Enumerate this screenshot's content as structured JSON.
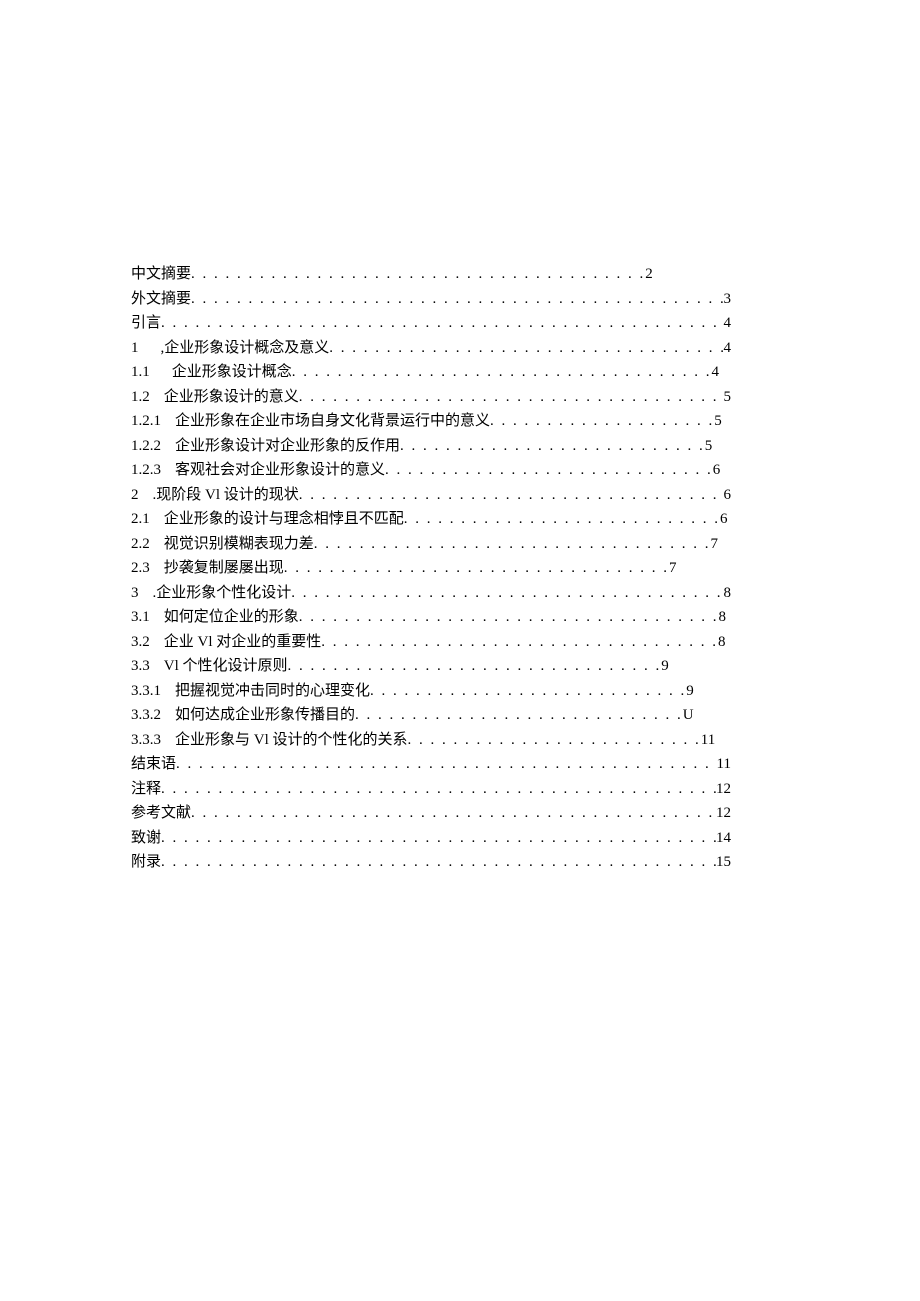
{
  "toc": [
    {
      "num": "",
      "title": "中文摘要",
      "dots": " . . . . . . . . . . . . . . . . . . . . . . . . . . . . . . . . . . . . . . . .",
      "page": "2"
    },
    {
      "num": "",
      "title": "外文摘要",
      "dots": ". . . . . . . . . . . . . . . . . . . . . . . . . . . . . . . . . . . . . . . . . . . . . . . . .",
      "page": "3"
    },
    {
      "num": "",
      "title": "引言",
      "dots": ". . . . . . . . . . . . . . . . . . . . . . . . . . . . . . . . . . . . . . . . . . . . . . . . . . . .",
      "page": "4"
    },
    {
      "num": "1",
      "title": ",企业形象设计概念及意义",
      "dots": " . . . . . . . . . . . . . . . . . . . . . . . . . . . . . . . . . . . . .",
      "page": "4",
      "wide": true
    },
    {
      "num": "1.1",
      "title": "企业形象设计概念",
      "dots": " . . . . . . . . . . . . . . . . . . . . . . . . . . . . . . . . . . . . .",
      "page": "4",
      "wide": true
    },
    {
      "num": "1.2",
      "title": "企业形象设计的意义",
      "dots": " . . . . . . . . . . . . . . . . . . . . . . . . . . . . . . . . . . . . . .",
      "page": "5"
    },
    {
      "num": "1.2.1",
      "title": "企业形象在企业市场自身文化背景运行中的意义",
      "dots": ". . . . . . . . . . . . . . . . . . . .",
      "page": "5"
    },
    {
      "num": "1.2.2",
      "title": "企业形象设计对企业形象的反作用",
      "dots": " . . . . . . . . . . . . . . . . . . . . . . . . . . .",
      "page": "5"
    },
    {
      "num": "1.2.3",
      "title": "客观社会对企业形象设计的意义",
      "dots": " . . . . . . . . . . . . . . . . . . . . . . . . . . . . .",
      "page": "6"
    },
    {
      "num": "2",
      "title": ".现阶段 Vl 设计的现状",
      "dots": " . . . . . . . . . . . . . . . . . . . . . . . . . . . . . . . . . . . . . .",
      "page": "6"
    },
    {
      "num": "2.1",
      "title": "企业形象的设计与理念相悖且不匹配",
      "dots": " . . . . . . . . . . . . . . . . . . . . . . . . . . . .",
      "page": "6"
    },
    {
      "num": "2.2",
      "title": "视觉识别模糊表现力差",
      "dots": " . . . . . . . . . . . . . . . . . . . . . . . . . . . . . . . . . . .",
      "page": "7"
    },
    {
      "num": "2.3",
      "title": "抄袭复制屡屡出现",
      "dots": ". . . . . . . . . . . . . . . . . . . . . . . . . . . . . . . . . .",
      "page": "7"
    },
    {
      "num": "3",
      "title": ".企业形象个性化设计",
      "dots": " . . . . . . . . . . . . . . . . . . . . . . . . . . . . . . . . . . . . . . .",
      "page": "8"
    },
    {
      "num": "3.1",
      "title": "如何定位企业的形象",
      "dots": " . . . . . . . . . . . . . . . . . . . . . . . . . . . . . . . . . . . . .",
      "page": "8"
    },
    {
      "num": "3.2",
      "title": "企业 Vl 对企业的重要性",
      "dots": " . . . . . . . . . . . . . . . . . . . . . . . . . . . . . . . . . . .",
      "page": "8"
    },
    {
      "num": "3.3",
      "title": "Vl 个性化设计原则",
      "dots": " . . . . . . . . . . . . . . . . . . . . . . . . . . . . . . . . .",
      "page": "9"
    },
    {
      "num": "3.3.1",
      "title": "把握视觉冲击同时的心理变化",
      "dots": " . . . . . . . . . . . . . . . . . . . . . . . . . . . .",
      "page": "9"
    },
    {
      "num": "3.3.2",
      "title": "如何达成企业形象传播目的",
      "dots": " . . . . . . . . . . . . . . . . . . . . . . . . . . . . .",
      "page": "U"
    },
    {
      "num": "3.3.3",
      "title": "企业形象与 Vl 设计的个性化的关系",
      "dots": " . . . . . . . . . . . . . . . . . . . . . . . . . .",
      "page": " 11"
    },
    {
      "num": "",
      "title": "结束语",
      "dots": ". . . . . . . . . . . . . . . . . . . . . . . . . . . . . . . . . . . . . . . . . . . . . . . . . .",
      "page": " 11"
    },
    {
      "num": "",
      "title": "注释",
      "dots": ". . . . . . . . . . . . . . . . . . . . . . . . . . . . . . . . . . . . . . . . . . . . . . . . . . . .",
      "page": " 12"
    },
    {
      "num": "",
      "title": "参考文献",
      "dots": ". . . . . . . . . . . . . . . . . . . . . . . . . . . . . . . . . . . . . . . . . . . . . . . . .",
      "page": " 12"
    },
    {
      "num": "",
      "title": "致谢",
      "dots": ". . . . . . . . . . . . . . . . . . . . . . . . . . . . . . . . . . . . . . . . . . . . . . . . . . . . . .",
      "page": " 14"
    },
    {
      "num": "",
      "title": "附录",
      "dots": ". . . . . . . . . . . . . . . . . . . . . . . . . . . . . . . . . . . . . . . . . . . . . . . . . .",
      "page": " 15"
    }
  ]
}
